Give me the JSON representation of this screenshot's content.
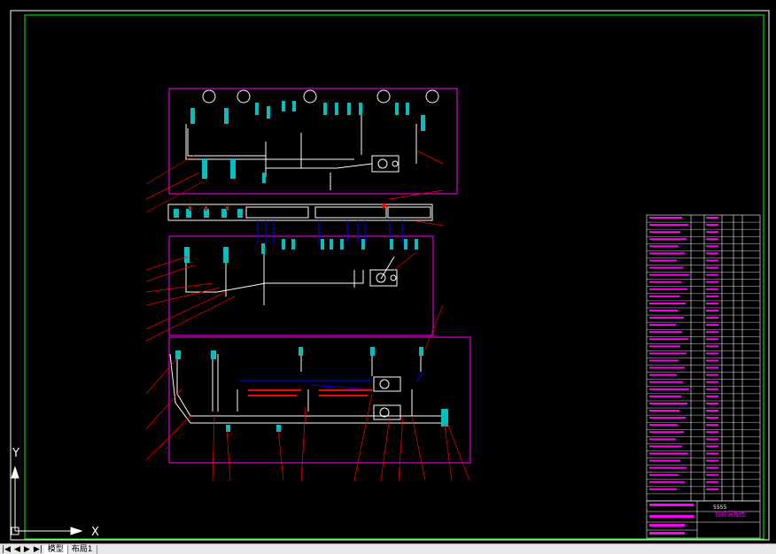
{
  "app": {
    "layout_tabs": [
      "模型",
      "布局1"
    ],
    "nav_buttons": [
      "|◀",
      "◀",
      "▶",
      "▶|"
    ],
    "ucs_x": "X",
    "ucs_y": "Y"
  },
  "colors": {
    "background": "#000000",
    "frame_green": "#00ff00",
    "magenta": "#ff00ff",
    "blue": "#0000ff",
    "cyan": "#00c0c0",
    "red": "#ff0000",
    "white": "#ffffff",
    "yellow": "#ffff00"
  },
  "drawing": {
    "title_block": {
      "stamp": "5555",
      "title": "管路装配图"
    }
  }
}
